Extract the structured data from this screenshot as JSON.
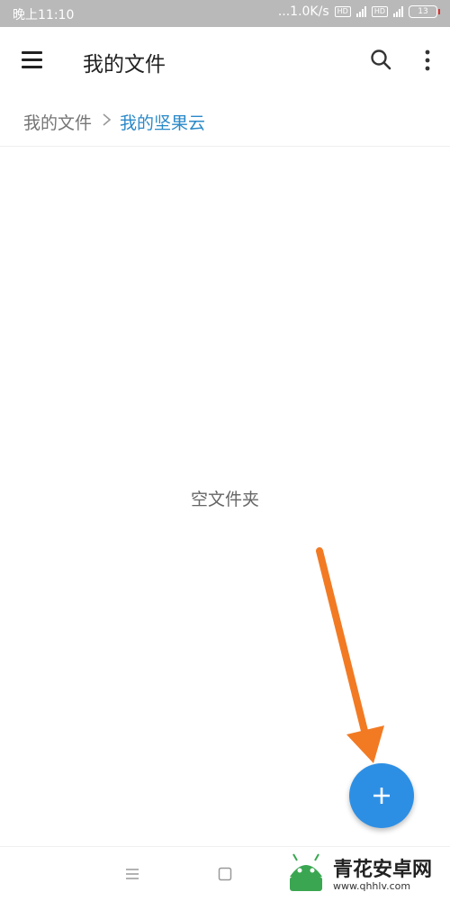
{
  "status_bar": {
    "time": "晚上11:10",
    "speed": "...1.0K/s",
    "signal_tag": "4G",
    "battery": "13"
  },
  "app_bar": {
    "title": "我的文件",
    "icons": [
      "hamburger-menu-icon",
      "search-icon",
      "more-vertical-icon"
    ]
  },
  "breadcrumb": {
    "root": "我的文件",
    "current": "我的坚果云"
  },
  "content": {
    "empty_text": "空文件夹"
  },
  "fab": {
    "icon": "plus-icon",
    "color": "#2d8fe4"
  },
  "annotation": {
    "arrow_color": "#f27a23"
  },
  "watermark": {
    "text": "青花安卓网",
    "url": "www.qhhlv.com"
  },
  "colors": {
    "accent": "#2a89c8",
    "status_bar": "#b9b9b9"
  }
}
